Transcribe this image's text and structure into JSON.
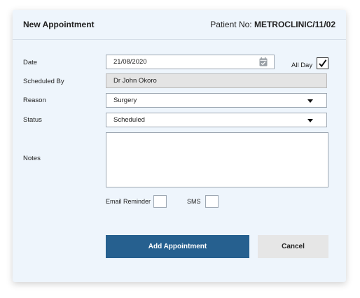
{
  "header": {
    "title": "New Appointment",
    "patient_label": "Patient No:",
    "patient_no": "METROCLINIC/11/02"
  },
  "form": {
    "date": {
      "label": "Date",
      "value": "21/08/2020",
      "icon": "calendar-icon"
    },
    "all_day": {
      "label": "All Day",
      "checked": true
    },
    "scheduled_by": {
      "label": "Scheduled By",
      "value": "Dr John Okoro"
    },
    "reason": {
      "label": "Reason",
      "value": "Surgery"
    },
    "status": {
      "label": "Status",
      "value": "Scheduled"
    },
    "notes": {
      "label": "Notes",
      "value": ""
    },
    "email_reminder": {
      "label": "Email Reminder",
      "checked": false
    },
    "sms": {
      "label": "SMS",
      "checked": false
    }
  },
  "actions": {
    "add_label": "Add Appointment",
    "cancel_label": "Cancel"
  },
  "colors": {
    "panel_bg": "#eef5fc",
    "primary_button": "#26608f",
    "secondary_button": "#e6e6e6",
    "disabled_field": "#e4e4e4"
  }
}
